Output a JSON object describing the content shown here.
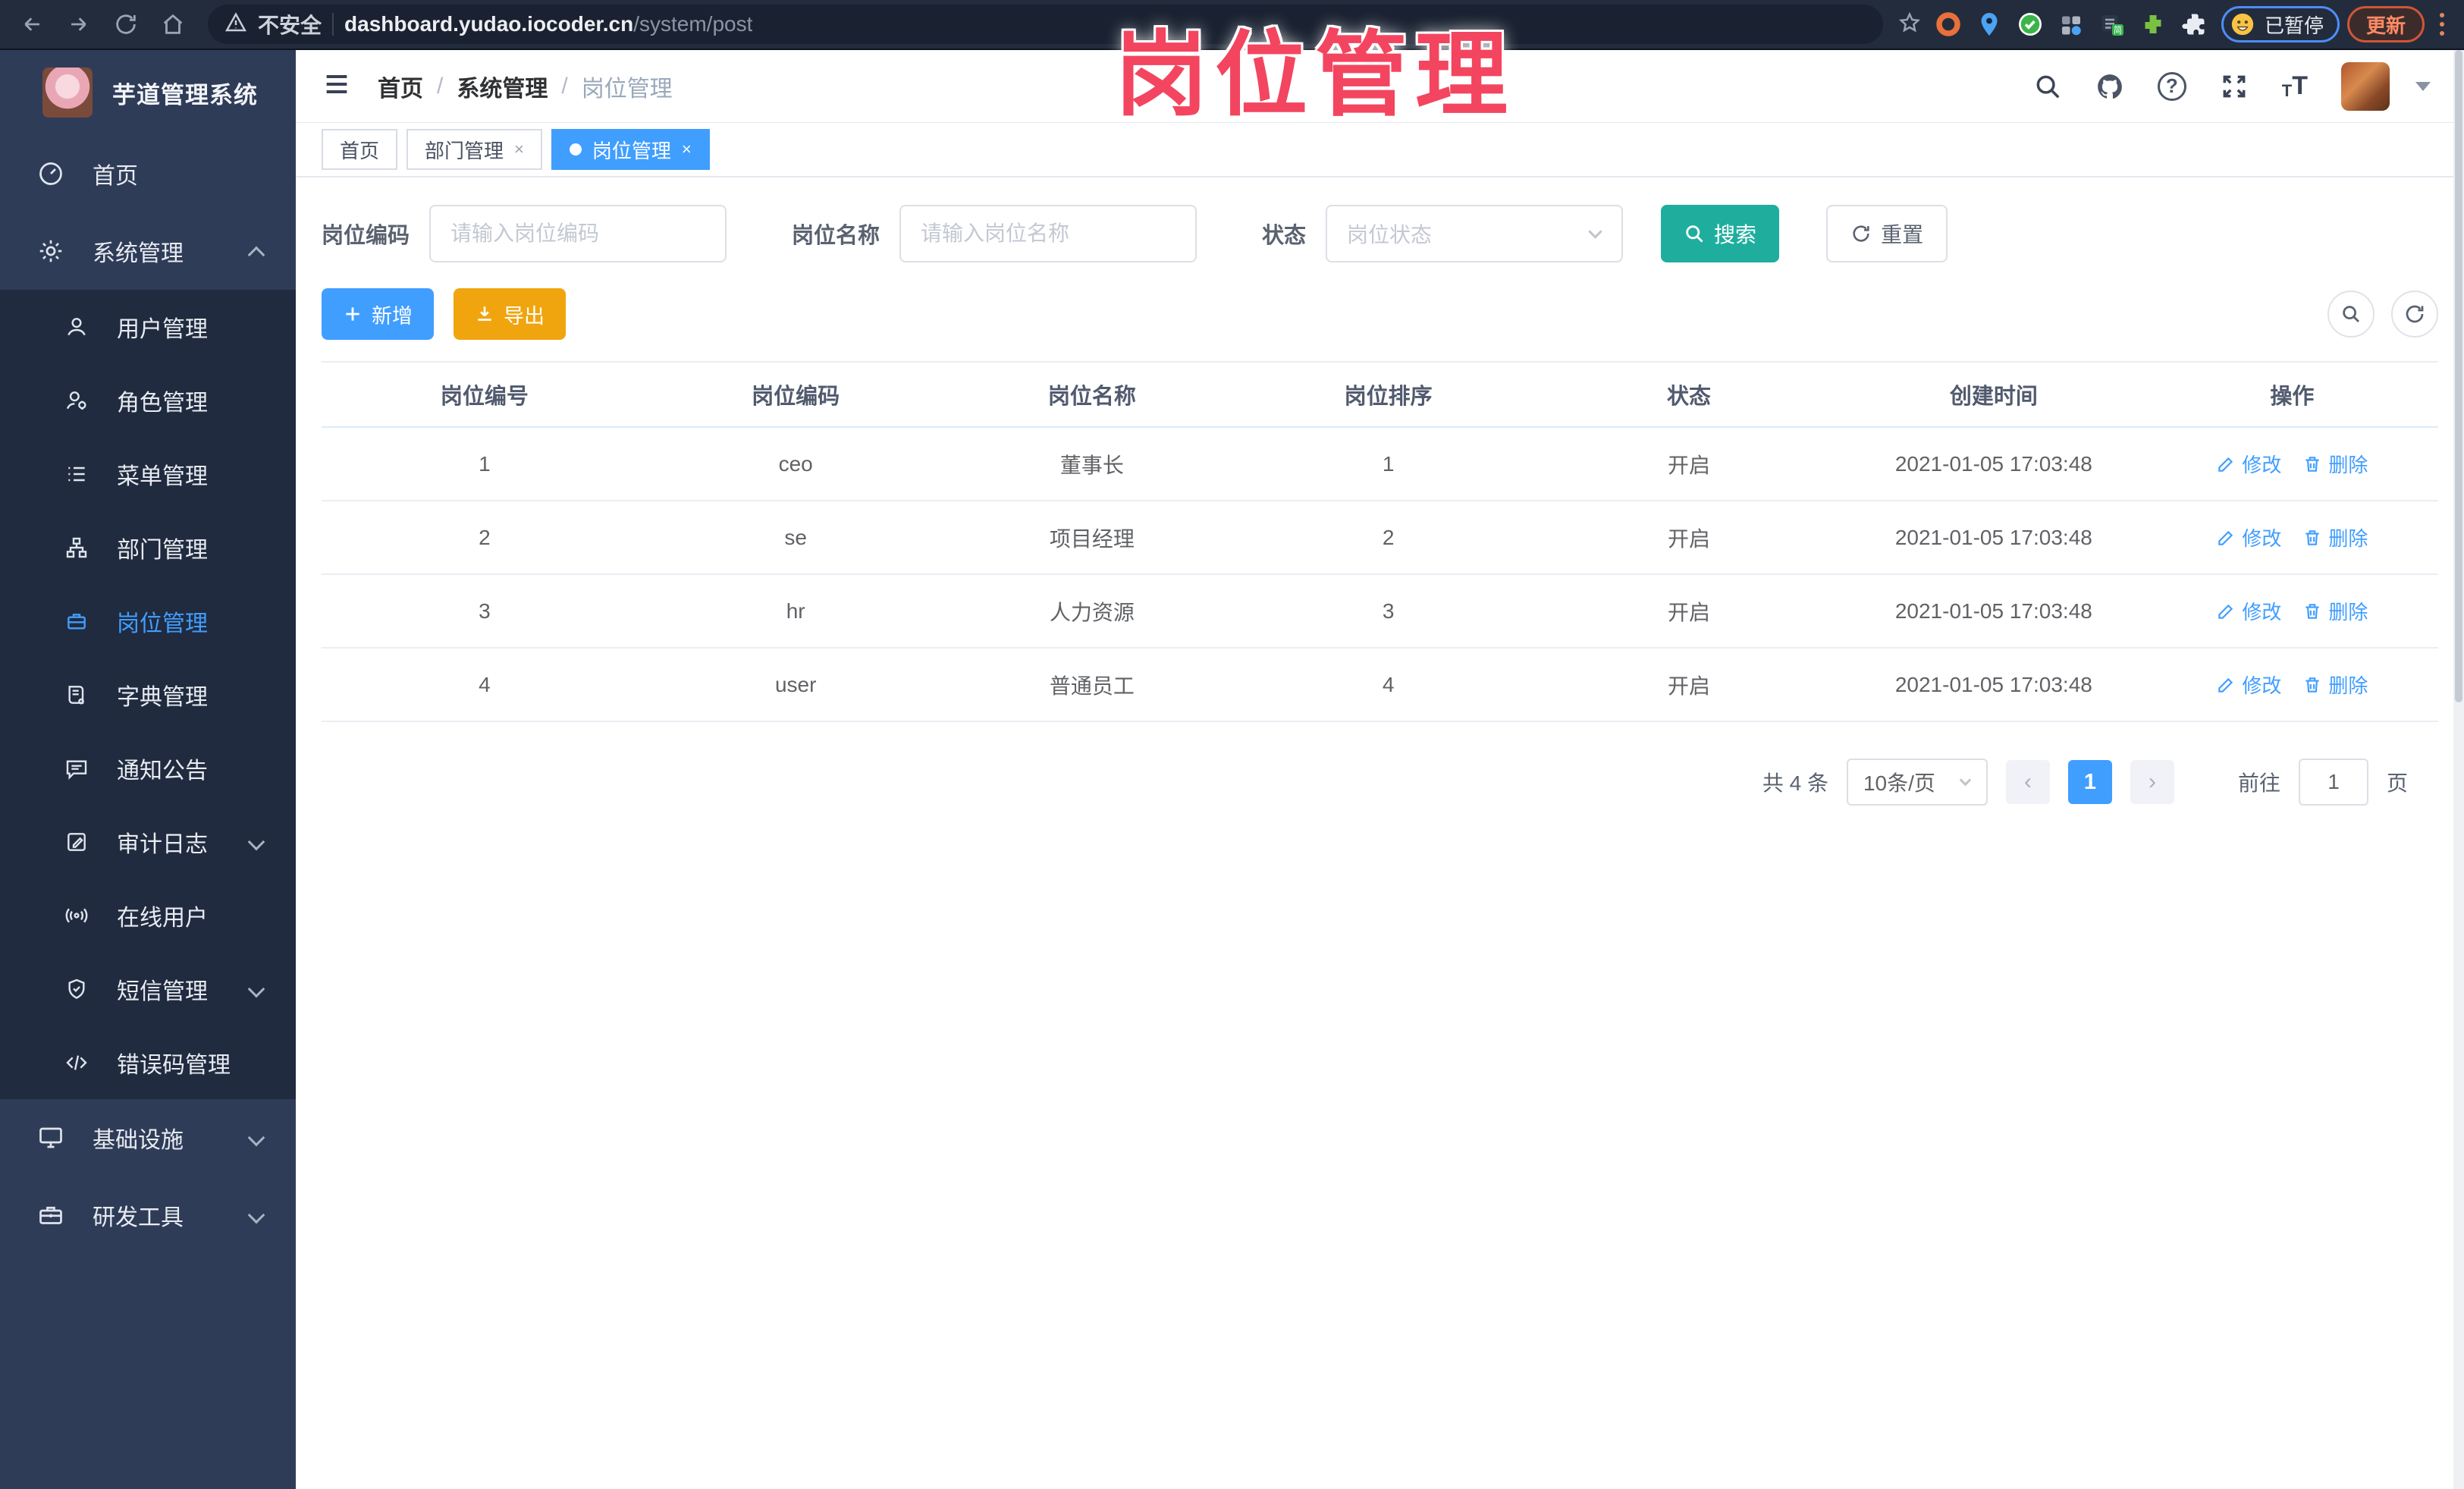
{
  "colors": {
    "accent": "#409eff",
    "search_teal": "#1fae9e",
    "export_amber": "#f0a50f",
    "overlay_pink": "#f3455f",
    "sidebar_bg": "#2f3c58",
    "submenu_bg": "#202b3f"
  },
  "browser": {
    "security_label": "不安全",
    "url_host": "dashboard.yudao.iocoder.cn",
    "url_path": "/system/post",
    "paused_label": "已暂停",
    "update_label": "更新"
  },
  "overlay": {
    "title": "岗位管理"
  },
  "sidebar": {
    "title": "芋道管理系统",
    "home_label": "首页",
    "system_label": "系统管理",
    "system_children": [
      {
        "label": "用户管理"
      },
      {
        "label": "角色管理"
      },
      {
        "label": "菜单管理"
      },
      {
        "label": "部门管理"
      },
      {
        "label": "岗位管理"
      },
      {
        "label": "字典管理"
      },
      {
        "label": "通知公告"
      },
      {
        "label": "审计日志"
      },
      {
        "label": "在线用户"
      },
      {
        "label": "短信管理"
      },
      {
        "label": "错误码管理"
      }
    ],
    "infra_label": "基础设施",
    "devtool_label": "研发工具"
  },
  "header": {
    "breadcrumb": [
      "首页",
      "系统管理",
      "岗位管理"
    ],
    "separator": "/"
  },
  "tabs": [
    {
      "label": "首页"
    },
    {
      "label": "部门管理"
    },
    {
      "label": "岗位管理"
    }
  ],
  "search": {
    "code_label": "岗位编码",
    "code_placeholder": "请输入岗位编码",
    "name_label": "岗位名称",
    "name_placeholder": "请输入岗位名称",
    "status_label": "状态",
    "status_placeholder": "岗位状态",
    "search_label": "搜索",
    "reset_label": "重置"
  },
  "toolbar": {
    "add_label": "新增",
    "export_label": "导出"
  },
  "table": {
    "columns": [
      "岗位编号",
      "岗位编码",
      "岗位名称",
      "岗位排序",
      "状态",
      "创建时间",
      "操作"
    ],
    "edit_label": "修改",
    "delete_label": "删除",
    "rows": [
      {
        "id": "1",
        "code": "ceo",
        "name": "董事长",
        "sort": "1",
        "status": "开启",
        "created": "2021-01-05 17:03:48"
      },
      {
        "id": "2",
        "code": "se",
        "name": "项目经理",
        "sort": "2",
        "status": "开启",
        "created": "2021-01-05 17:03:48"
      },
      {
        "id": "3",
        "code": "hr",
        "name": "人力资源",
        "sort": "3",
        "status": "开启",
        "created": "2021-01-05 17:03:48"
      },
      {
        "id": "4",
        "code": "user",
        "name": "普通员工",
        "sort": "4",
        "status": "开启",
        "created": "2021-01-05 17:03:48"
      }
    ]
  },
  "pagination": {
    "total_label": "共 4 条",
    "page_size": "10条/页",
    "current_page": "1",
    "goto_label": "前往",
    "goto_value": "1",
    "unit_label": "页"
  }
}
